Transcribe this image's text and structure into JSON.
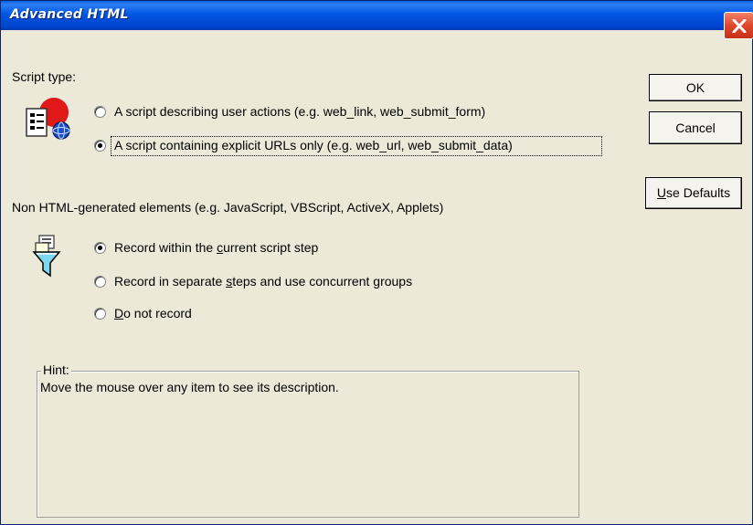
{
  "window": {
    "title": "Advanced HTML"
  },
  "script_type": {
    "label": "Script type:",
    "options": [
      {
        "text": "A script describing user actions (e.g. web_link, web_submit_form)",
        "checked": false
      },
      {
        "text": "A script containing explicit URLs only (e.g. web_url, web_submit_data)",
        "checked": true
      }
    ]
  },
  "non_html": {
    "label": "Non HTML-generated elements (e.g. JavaScript, VBScript, ActiveX, Applets)",
    "options": [
      {
        "pre": "Record within the ",
        "key": "c",
        "post": "urrent script step",
        "checked": true
      },
      {
        "pre": "Record in separate ",
        "key": "s",
        "post": "teps and use concurrent groups",
        "checked": false
      },
      {
        "pre": "",
        "key": "D",
        "post": "o not record",
        "checked": false
      }
    ]
  },
  "buttons": {
    "ok": "OK",
    "cancel": "Cancel",
    "defaults_key": "U",
    "defaults_rest": "se Defaults"
  },
  "hint": {
    "legend": "Hint:",
    "text": "Move the mouse over any item to see its description."
  }
}
